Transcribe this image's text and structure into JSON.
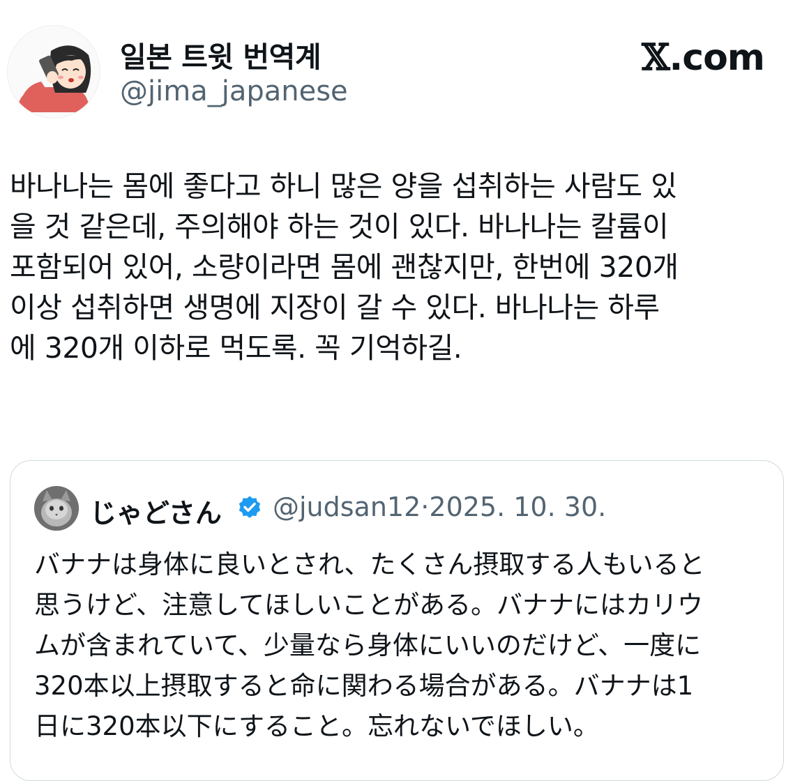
{
  "tweet": {
    "author": {
      "display_name": "일본 트윗 번역계",
      "handle": "@jima_japanese",
      "avatar_icon": "girl-with-phone-avatar"
    },
    "brand": {
      "mark": "𝕏",
      "suffix": ".com"
    },
    "text": "바나나는 몸에 좋다고 하니 많은 양을 섭취하는 사람도 있\n을 것 같은데, 주의해야 하는 것이 있다. 바나나는 칼륨이\n포함되어 있어, 소량이라면 몸에 괜찮지만, 한번에 320개\n이상 섭취하면 생명에 지장이 갈 수 있다. 바나나는 하루\n에 320개 이하로 먹도록. 꼭 기억하길."
  },
  "quoted_tweet": {
    "author": {
      "display_name": "じゃどさん",
      "handle": "@judsan12",
      "avatar_icon": "cat-avatar",
      "verified": true
    },
    "separator": "·",
    "date": "2025. 10. 30.",
    "text": "バナナは身体に良いとされ、たくさん摂取する人もいると\n思うけど、注意してほしいことがある。バナナにはカリウ\nムが含まれていて、少量なら身体にいいのだけど、一度に\n320本以上摂取すると命に関わる場合がある。バナナは1\n日に320本以下にすること。忘れないでほしい。"
  },
  "colors": {
    "text_primary": "#0f1419",
    "text_secondary": "#536471",
    "border": "#cfd9de",
    "verified_blue": "#1d9bf0"
  }
}
